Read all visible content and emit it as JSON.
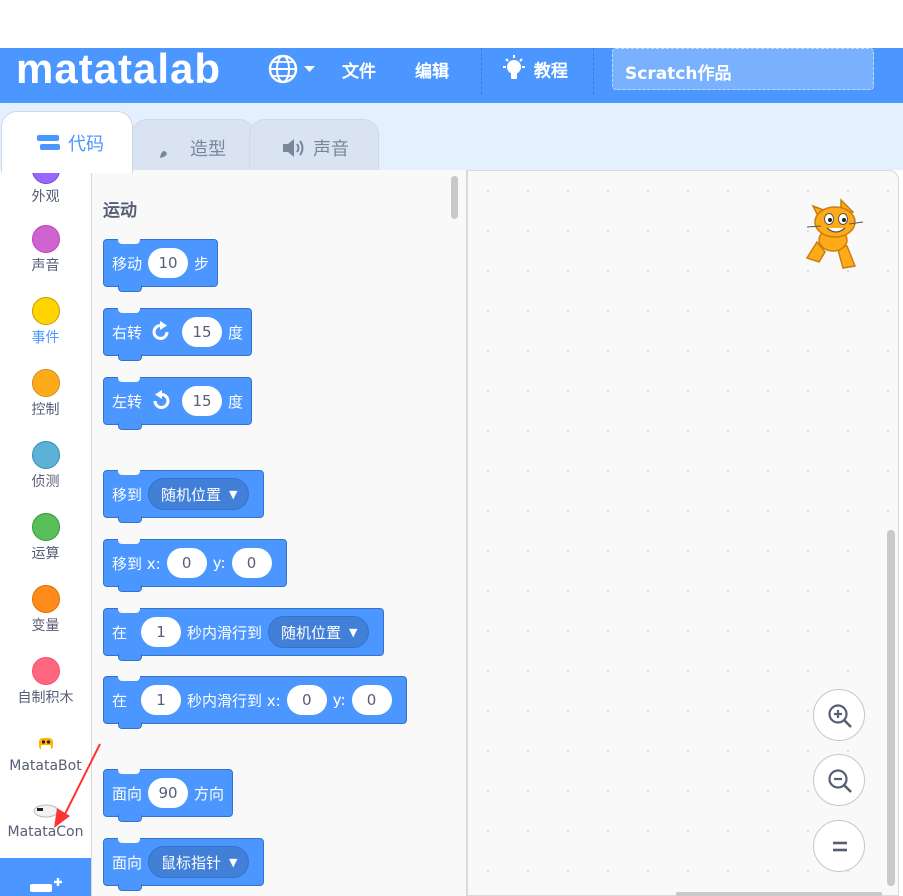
{
  "colors": {
    "brand": "#4c97ff",
    "block_border": "#3373cc",
    "arrow": "#ff3333"
  },
  "menubar": {
    "logo": "matatalab",
    "globe_icon": "globe-icon",
    "file": "文件",
    "edit": "编辑",
    "tutorial": "教程",
    "project_title": "Scratch作品"
  },
  "tabs": [
    {
      "label": "代码",
      "icon": "code-icon"
    },
    {
      "label": "造型",
      "icon": "brush-icon"
    },
    {
      "label": "声音",
      "icon": "speaker-icon"
    }
  ],
  "categories": [
    {
      "label": "外观",
      "color": "#9966ff"
    },
    {
      "label": "声音",
      "color": "#cf63cf"
    },
    {
      "label": "事件",
      "color": "#ffd500"
    },
    {
      "label": "控制",
      "color": "#ffab19"
    },
    {
      "label": "侦测",
      "color": "#5cb1d6"
    },
    {
      "label": "运算",
      "color": "#59c059"
    },
    {
      "label": "变量",
      "color": "#ff8c1a"
    },
    {
      "label": "自制积木",
      "color": "#ff6680"
    },
    {
      "label": "MatataBot"
    },
    {
      "label": "MatataCon"
    }
  ],
  "palette": {
    "heading": "运动",
    "blocks": {
      "move": {
        "label": "移动",
        "value": "10",
        "unit": "步"
      },
      "turn_right": {
        "label": "右转",
        "value": "15",
        "unit": "度"
      },
      "turn_left": {
        "label": "左转",
        "value": "15",
        "unit": "度"
      },
      "goto": {
        "label": "移到",
        "menu": "随机位置"
      },
      "goto_xy": {
        "label": "移到 x:",
        "x": "0",
        "y_label": "y:",
        "y": "0"
      },
      "glide": {
        "label": "在",
        "value": "1",
        "mid": "秒内滑行到",
        "menu": "随机位置"
      },
      "glide_xy": {
        "label": "在",
        "value": "1",
        "mid": "秒内滑行到 x:",
        "x": "0",
        "y_label": "y:",
        "y": "0"
      },
      "point_dir": {
        "label": "面向",
        "value": "90",
        "unit": "方向"
      },
      "point_towards": {
        "label": "面向",
        "menu": "鼠标指针"
      }
    }
  }
}
